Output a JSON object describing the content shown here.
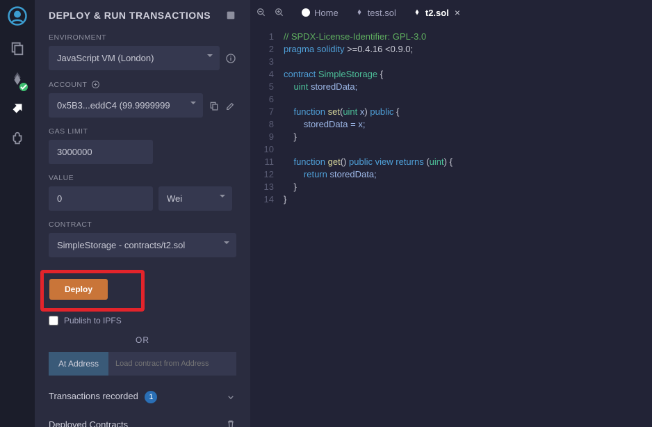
{
  "iconbar": {
    "items": [
      "logo",
      "files",
      "compile",
      "deploy",
      "plugin"
    ]
  },
  "panel": {
    "title": "DEPLOY & RUN TRANSACTIONS",
    "environment_label": "ENVIRONMENT",
    "environment_value": "JavaScript VM (London)",
    "account_label": "ACCOUNT",
    "account_value": "0x5B3...eddC4 (99.9999999",
    "gaslimit_label": "GAS LIMIT",
    "gaslimit_value": "3000000",
    "value_label": "VALUE",
    "value_value": "0",
    "value_unit": "Wei",
    "contract_label": "CONTRACT",
    "contract_value": "SimpleStorage - contracts/t2.sol",
    "deploy_label": "Deploy",
    "publish_label": "Publish to IPFS",
    "or_label": "OR",
    "ataddr_label": "At Address",
    "ataddr_placeholder": "Load contract from Address",
    "tx_recorded_label": "Transactions recorded",
    "tx_recorded_count": "1",
    "deployed_label": "Deployed Contracts"
  },
  "tabs": {
    "home": "Home",
    "t1": "test.sol",
    "t2": "t2.sol"
  },
  "code": {
    "l1": "// SPDX-License-Identifier: GPL-3.0",
    "l2a": "pragma",
    "l2b": "solidity",
    "l2c": ">=0.4.16 <0.9.0;",
    "l4a": "contract",
    "l4b": "SimpleStorage",
    "l4c": "{",
    "l5a": "uint",
    "l5b": "storedData;",
    "l7a": "function",
    "l7b": "set",
    "l7c": "(",
    "l7d": "uint",
    "l7e": "x",
    "l7f": ")",
    "l7g": "public",
    "l7h": "{",
    "l8a": "storedData = x;",
    "l9a": "}",
    "l11a": "function",
    "l11b": "get",
    "l11c": "()",
    "l11d": "public",
    "l11e": "view",
    "l11f": "returns",
    "l11g": "(",
    "l11h": "uint",
    "l11i": ") {",
    "l12a": "return",
    "l12b": "storedData;",
    "l13a": "}",
    "l14a": "}"
  },
  "lines": [
    "1",
    "2",
    "3",
    "4",
    "5",
    "6",
    "7",
    "8",
    "9",
    "10",
    "11",
    "12",
    "13",
    "14"
  ]
}
